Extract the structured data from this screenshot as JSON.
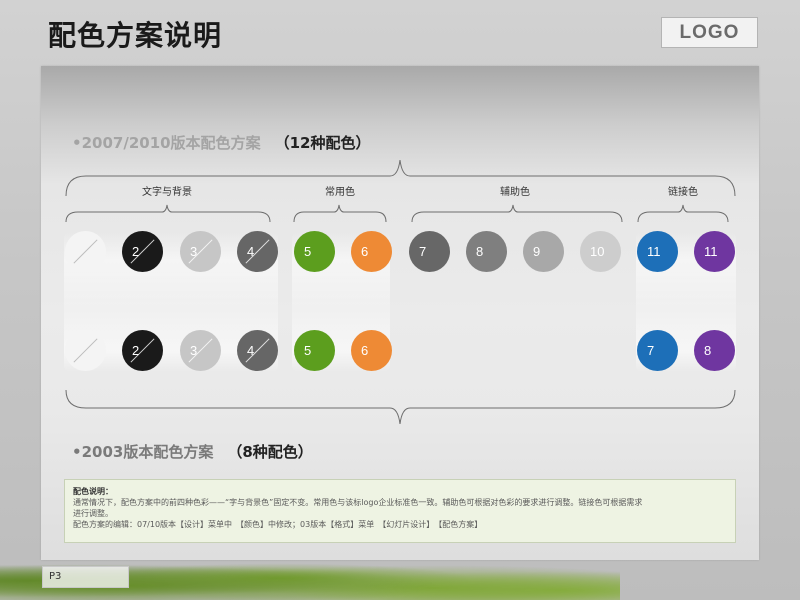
{
  "header": {
    "title": "配色方案说明",
    "logo_text": "LOGO"
  },
  "section_2010": {
    "label": "•2007/2010版本配色方案",
    "count": "（12种配色）"
  },
  "section_2003": {
    "label": "•2003版本配色方案",
    "count": "（8种配色）"
  },
  "groups": {
    "text_bg": "文字与背景",
    "common": "常用色",
    "auxiliary": "辅助色",
    "link": "链接色"
  },
  "swatches_2010": [
    {
      "num": "",
      "color": "#f4f4f4"
    },
    {
      "num": "2",
      "color": "#1a1a1a"
    },
    {
      "num": "3",
      "color": "#c6c6c6"
    },
    {
      "num": "4",
      "color": "#666666"
    },
    {
      "num": "5",
      "color": "#5c9e1e"
    },
    {
      "num": "6",
      "color": "#ee8a35"
    },
    {
      "num": "7",
      "color": "#676767"
    },
    {
      "num": "8",
      "color": "#7f7f7f"
    },
    {
      "num": "9",
      "color": "#a8a8a8"
    },
    {
      "num": "10",
      "color": "#cdcdcd"
    },
    {
      "num": "11",
      "color": "#1d6fb8"
    },
    {
      "num": "11",
      "color": "#6f36a0"
    }
  ],
  "swatches_2003": [
    {
      "num": "",
      "color": "#f4f4f4"
    },
    {
      "num": "2",
      "color": "#1a1a1a"
    },
    {
      "num": "3",
      "color": "#c6c6c6"
    },
    {
      "num": "4",
      "color": "#666666"
    },
    {
      "num": "5",
      "color": "#5c9e1e"
    },
    {
      "num": "6",
      "color": "#ee8a35"
    },
    {
      "num": "7",
      "color": "#1d6fb8"
    },
    {
      "num": "8",
      "color": "#6f36a0"
    }
  ],
  "note": {
    "title": "配色说明：",
    "line1": "通常情况下，配色方案中的前四种色彩——“字与背景色”固定不变。常用色与该标logo企业标准色一致。辅助色可根据对色彩的要求进行调整。链接色可根据需求",
    "line2": "进行调整。",
    "line3": "配色方案的编辑：07/10版本【设计】菜单中　【颜色】中修改；03版本【格式】菜单　【幻灯片设计】　【配色方案】"
  },
  "footer": {
    "page_number": "P3"
  }
}
